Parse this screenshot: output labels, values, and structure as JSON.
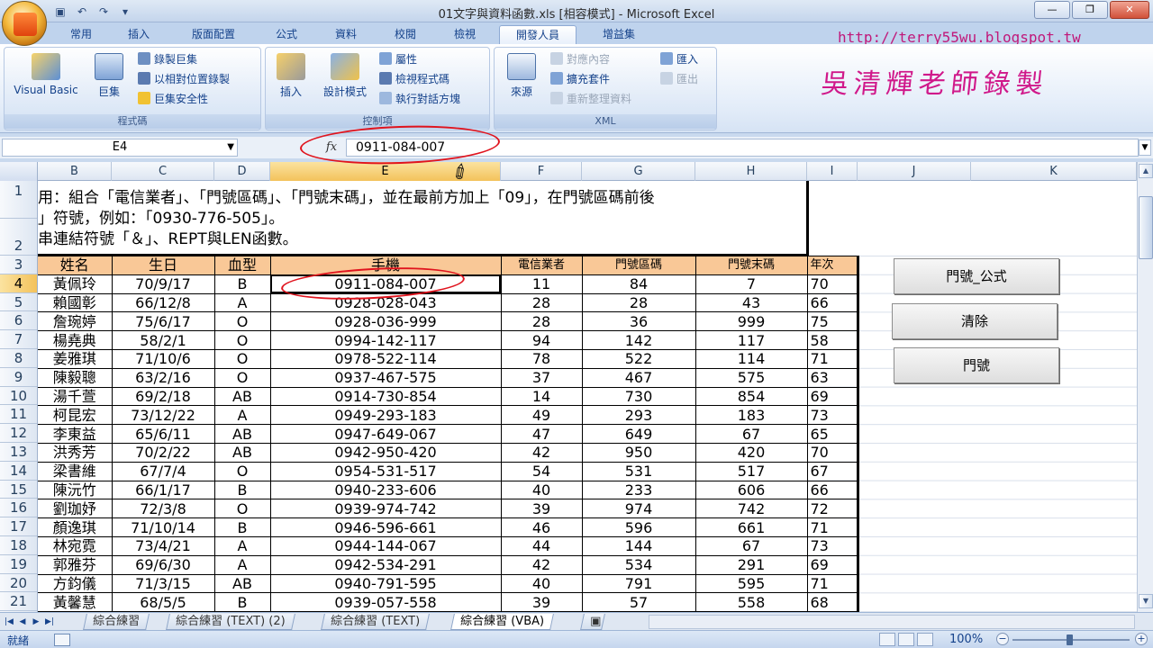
{
  "title": "01文字與資料函數.xls [相容模式] - Microsoft Excel",
  "watermark": {
    "url": "http://terry55wu.blogspot.tw",
    "author": "吳清輝老師錄製"
  },
  "window_controls": {
    "minimize": "—",
    "restore": "❐",
    "close": "✕"
  },
  "qat": {
    "save": "▣",
    "undo": "↶",
    "redo": "↷",
    "more": "▾"
  },
  "tabs": [
    "常用",
    "插入",
    "版面配置",
    "公式",
    "資料",
    "校閱",
    "檢視",
    "開發人員",
    "增益集"
  ],
  "active_tab": "開發人員",
  "ribbon": {
    "code_group": {
      "label": "程式碼",
      "visual_basic": "Visual Basic",
      "macros": "巨集",
      "record_macro": "錄製巨集",
      "relative_ref": "以相對位置錄製",
      "macro_security": "巨集安全性"
    },
    "controls_group": {
      "label": "控制項",
      "insert": "插入",
      "design_mode": "設計模式",
      "properties": "屬性",
      "view_code": "檢視程式碼",
      "run_dialog": "執行對話方塊"
    },
    "xml_group": {
      "label": "XML",
      "source": "來源",
      "map_properties": "對應內容",
      "expansion_packs": "擴充套件",
      "refresh_data": "重新整理資料",
      "import": "匯入",
      "export": "匯出"
    }
  },
  "formula_bar": {
    "name_box": "E4",
    "fx": "fx",
    "formula": "0911-084-007"
  },
  "columns": [
    "B",
    "C",
    "D",
    "E",
    "F",
    "G",
    "H",
    "I",
    "J",
    "K"
  ],
  "rows": [
    "1",
    "2",
    "3",
    "4",
    "5",
    "6",
    "7",
    "8",
    "9",
    "10",
    "11",
    "12",
    "13",
    "14",
    "15",
    "16",
    "17",
    "18",
    "19",
    "20",
    "21"
  ],
  "description": {
    "line1": "用：組合「電信業者」、「門號區碼」、「門號末碼」，並在最前方加上「09」，在門號區碼前後",
    "line2": "」符號，例如：「0930-776-505」。",
    "line3": "串連結符號「＆」、REPT與LEN函數。"
  },
  "table": {
    "headers": [
      "姓名",
      "生日",
      "血型",
      "手機",
      "電信業者",
      "門號區碼",
      "門號末碼",
      "年次"
    ],
    "rows": [
      [
        "黃佩玲",
        "70/9/17",
        "B",
        "0911-084-007",
        "11",
        "84",
        "7",
        "70"
      ],
      [
        "賴國彰",
        "66/12/8",
        "A",
        "0928-028-043",
        "28",
        "28",
        "43",
        "66"
      ],
      [
        "詹琬婷",
        "75/6/17",
        "O",
        "0928-036-999",
        "28",
        "36",
        "999",
        "75"
      ],
      [
        "楊堯典",
        "58/2/1",
        "O",
        "0994-142-117",
        "94",
        "142",
        "117",
        "58"
      ],
      [
        "姜雅琪",
        "71/10/6",
        "O",
        "0978-522-114",
        "78",
        "522",
        "114",
        "71"
      ],
      [
        "陳毅聰",
        "63/2/16",
        "O",
        "0937-467-575",
        "37",
        "467",
        "575",
        "63"
      ],
      [
        "湯千萱",
        "69/2/18",
        "AB",
        "0914-730-854",
        "14",
        "730",
        "854",
        "69"
      ],
      [
        "柯昆宏",
        "73/12/22",
        "A",
        "0949-293-183",
        "49",
        "293",
        "183",
        "73"
      ],
      [
        "李東益",
        "65/6/11",
        "AB",
        "0947-649-067",
        "47",
        "649",
        "67",
        "65"
      ],
      [
        "洪秀芳",
        "70/2/22",
        "AB",
        "0942-950-420",
        "42",
        "950",
        "420",
        "70"
      ],
      [
        "梁書維",
        "67/7/4",
        "O",
        "0954-531-517",
        "54",
        "531",
        "517",
        "67"
      ],
      [
        "陳沅竹",
        "66/1/17",
        "B",
        "0940-233-606",
        "40",
        "233",
        "606",
        "66"
      ],
      [
        "劉珈妤",
        "72/3/8",
        "O",
        "0939-974-742",
        "39",
        "974",
        "742",
        "72"
      ],
      [
        "顏逸琪",
        "71/10/14",
        "B",
        "0946-596-661",
        "46",
        "596",
        "661",
        "71"
      ],
      [
        "林宛霓",
        "73/4/21",
        "A",
        "0944-144-067",
        "44",
        "144",
        "67",
        "73"
      ],
      [
        "郭雅芬",
        "69/6/30",
        "A",
        "0942-534-291",
        "42",
        "534",
        "291",
        "69"
      ],
      [
        "方鈞儀",
        "71/3/15",
        "AB",
        "0940-791-595",
        "40",
        "791",
        "595",
        "71"
      ],
      [
        "黃馨慧",
        "68/5/5",
        "B",
        "0939-057-558",
        "39",
        "57",
        "558",
        "68"
      ]
    ]
  },
  "vba_buttons": [
    "門號_公式",
    "清除",
    "門號"
  ],
  "sheet_tabs": [
    "綜合練習",
    "綜合練習 (TEXT) (2)",
    "綜合練習 (TEXT)",
    "綜合練習 (VBA)"
  ],
  "active_sheet": "綜合練習 (VBA)",
  "status": {
    "ready": "就緒",
    "zoom": "100%"
  },
  "colors": {
    "header_fill": "#f9c897",
    "annotation": "#e0141e",
    "watermark": "#d0188a"
  }
}
